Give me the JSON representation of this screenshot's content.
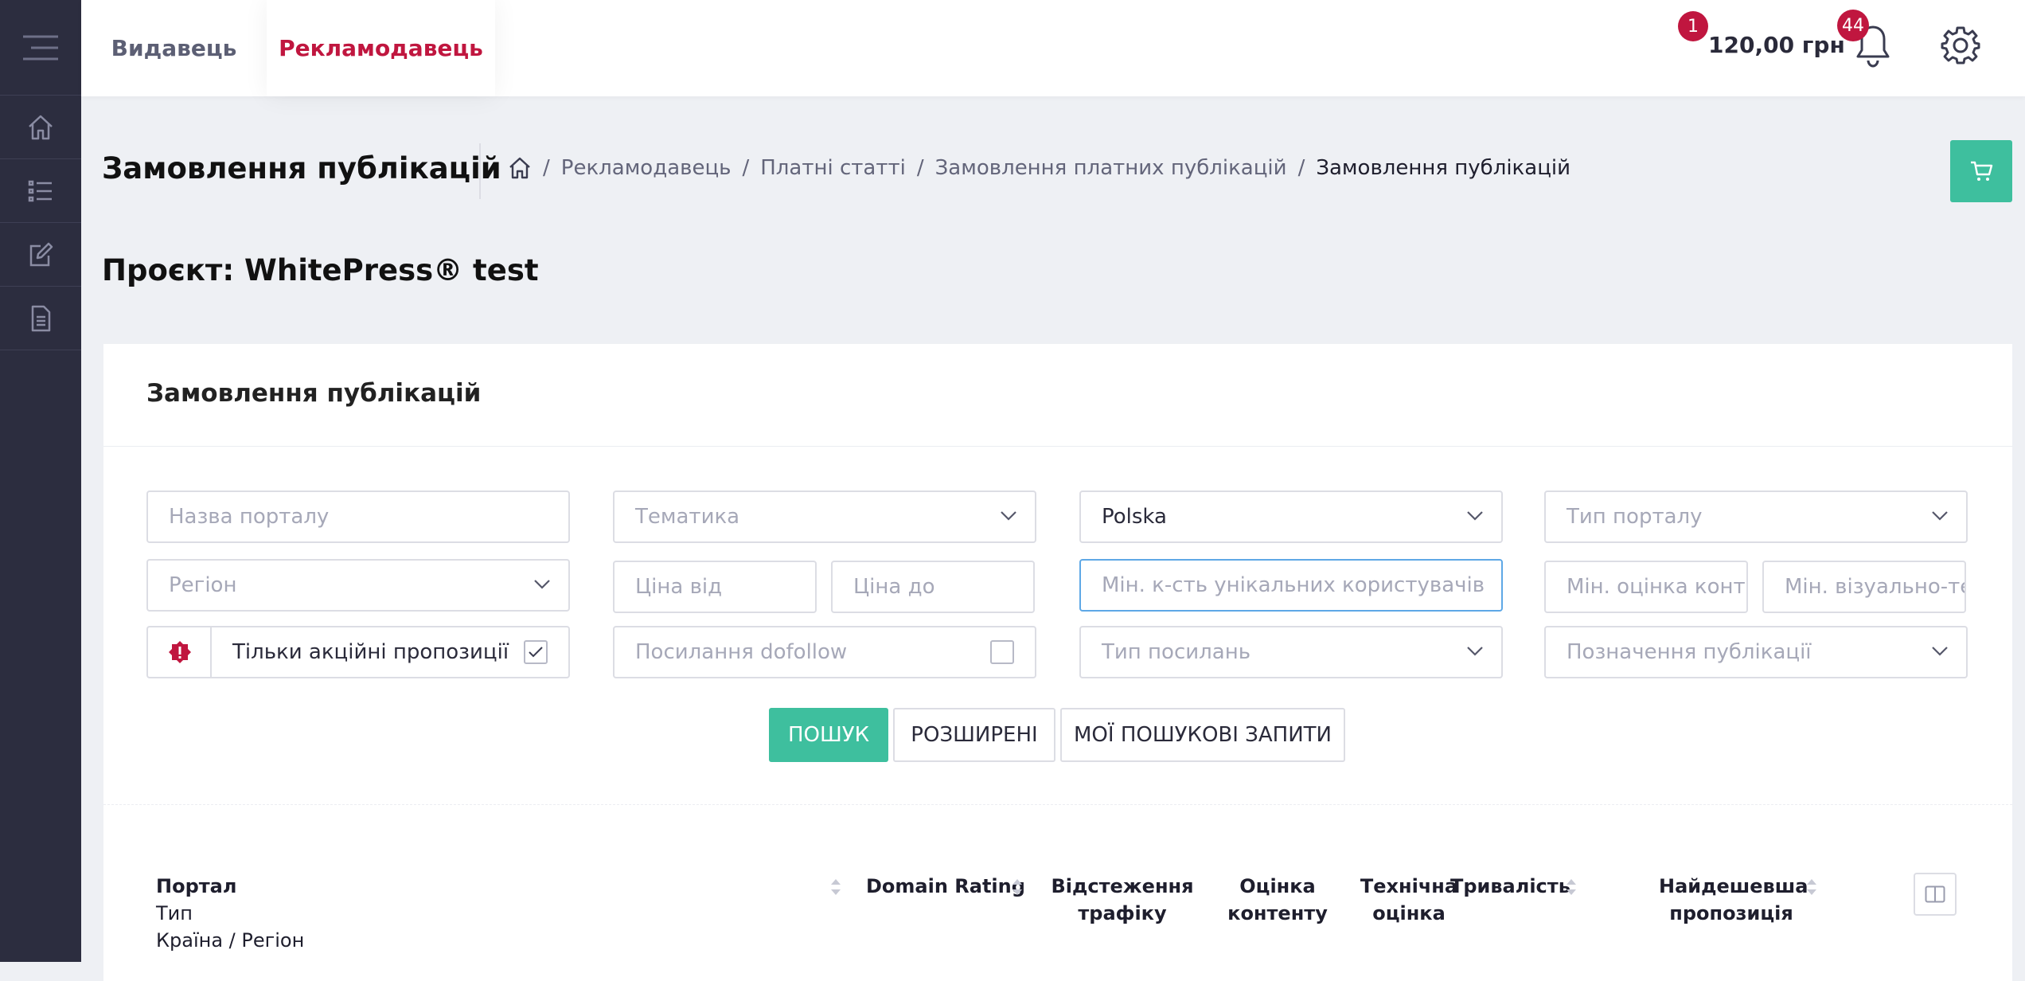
{
  "header": {
    "tabs": [
      "Видавець",
      "Рекламодавець"
    ],
    "active_tab": "Рекламодавець",
    "balance": "120,00 грн",
    "balance_badge": "1",
    "notifications_count": "44"
  },
  "sidebar": {
    "icons": [
      "menu-icon",
      "home-icon",
      "list-icon",
      "edit-icon",
      "document-icon"
    ]
  },
  "page": {
    "title": "Замовлення публікацій",
    "project": "Проєкт: WhitePress® test"
  },
  "breadcrumb": {
    "items": [
      "Рекламодавець",
      "Платні статті",
      "Замовлення платних публікацій",
      "Замовлення публікацій"
    ]
  },
  "card": {
    "title": "Замовлення публікацій"
  },
  "filters": {
    "portal_name_placeholder": "Назва порталу",
    "topic_placeholder": "Тематика",
    "country_value": "Polska",
    "portal_type_placeholder": "Тип порталу",
    "region_placeholder": "Регіон",
    "price_from_placeholder": "Ціна від",
    "price_to_placeholder": "Ціна до",
    "min_users_placeholder": "Мін. к-сть унікальних користувачів",
    "min_content_placeholder": "Мін. оцінка конте",
    "min_visual_placeholder": "Мін. візуально-те",
    "promo_only_label": "Тільки акційні пропозиції",
    "promo_only_checked": true,
    "dofollow_label": "Посилання dofollow",
    "dofollow_checked": false,
    "link_type_placeholder": "Тип посилань",
    "publication_label_placeholder": "Позначення публікації"
  },
  "actions": {
    "search": "ПОШУК",
    "advanced": "РОЗШИРЕНІ",
    "my_queries": "МОЇ ПОШУКОВІ ЗАПИТИ"
  },
  "table": {
    "columns": {
      "portal": "Портал",
      "portal_sub": [
        "Тип",
        "Країна / Регіон"
      ],
      "domain_rating": "Domain Rating",
      "traffic_1": "Відстеження",
      "traffic_2": "трафіку",
      "content_1": "Оцінка",
      "content_2": "контенту",
      "tech_1": "Технічна",
      "tech_2": "оцінка",
      "duration": "Тривалість",
      "cheapest_1": "Найдешевша",
      "cheapest_2": "пропозиція"
    }
  },
  "colors": {
    "accent": "#c0163f",
    "primary": "#3ebf9e",
    "sidebar": "#2c2d3f"
  }
}
